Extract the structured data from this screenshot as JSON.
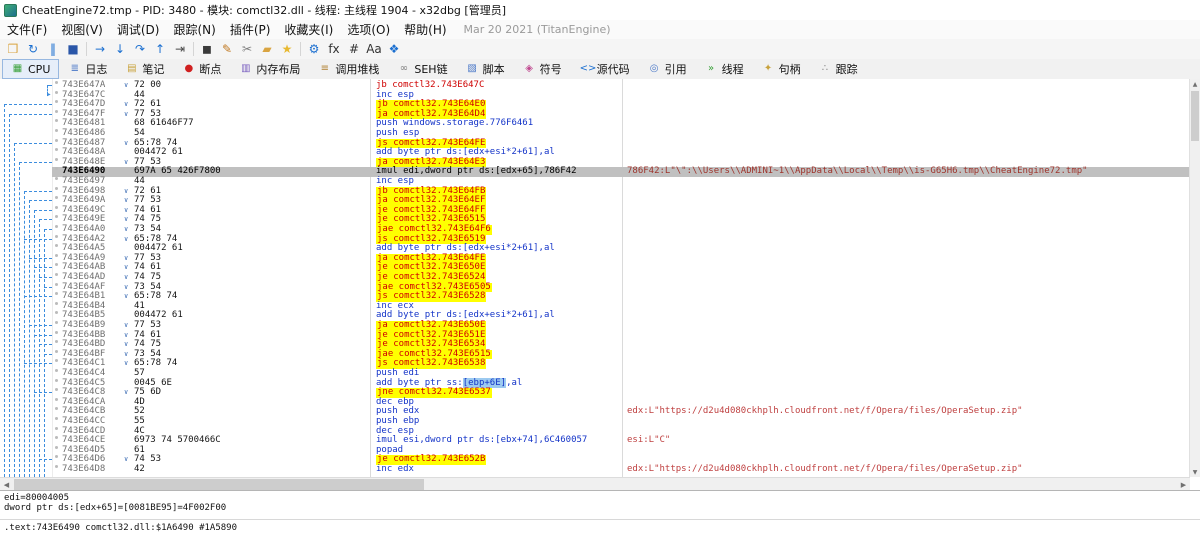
{
  "title_bar": {
    "title": "CheatEngine72.tmp - PID: 3480 - 模块: comctl32.dll - 线程: 主线程 1904 - x32dbg [管理员]"
  },
  "menu_bar": {
    "items": [
      {
        "label": "文件(F)",
        "name": "menu-file"
      },
      {
        "label": "视图(V)",
        "name": "menu-view"
      },
      {
        "label": "调试(D)",
        "name": "menu-debug"
      },
      {
        "label": "跟踪(N)",
        "name": "menu-trace"
      },
      {
        "label": "插件(P)",
        "name": "menu-plugins"
      },
      {
        "label": "收藏夹(I)",
        "name": "menu-favourites"
      },
      {
        "label": "选项(O)",
        "name": "menu-options"
      },
      {
        "label": "帮助(H)",
        "name": "menu-help"
      }
    ],
    "build_info": "Mar 20 2021 (TitanEngine)"
  },
  "toolbar": {
    "buttons": [
      {
        "name": "open-file",
        "glyph": "❒",
        "color": "#d9a441"
      },
      {
        "name": "restart",
        "glyph": "↻",
        "color": "#1b6fd0"
      },
      {
        "name": "pause",
        "glyph": "‖",
        "color": "#1b6fd0"
      },
      {
        "name": "stop",
        "glyph": "■",
        "color": "#2a56a8"
      },
      {
        "sep": true
      },
      {
        "name": "run",
        "glyph": "→",
        "color": "#1b6fd0"
      },
      {
        "name": "step-into",
        "glyph": "↓",
        "color": "#1b6fd0"
      },
      {
        "name": "step-over",
        "glyph": "↷",
        "color": "#1b6fd0"
      },
      {
        "name": "step-out",
        "glyph": "↑",
        "color": "#1b6fd0"
      },
      {
        "name": "run-to-user-code",
        "glyph": "⇥",
        "color": "#4a4a4a"
      },
      {
        "sep": true
      },
      {
        "name": "animate-into",
        "glyph": "◼",
        "color": "#3a3a3a"
      },
      {
        "name": "notes-pencil",
        "glyph": "✎",
        "color": "#c07820"
      },
      {
        "name": "snip",
        "glyph": "✂",
        "color": "#808080"
      },
      {
        "name": "patches",
        "glyph": "▰",
        "color": "#d9a441"
      },
      {
        "name": "favourites",
        "glyph": "★",
        "color": "#e8b931"
      },
      {
        "sep": true
      },
      {
        "name": "settings-gear",
        "glyph": "⚙",
        "color": "#1b6fd0"
      },
      {
        "name": "calculator-fx",
        "glyph": "fx",
        "color": "#333333"
      },
      {
        "name": "breakpoint-hash",
        "glyph": "#",
        "color": "#333333"
      },
      {
        "name": "strings-az",
        "glyph": "Aa",
        "color": "#333333"
      },
      {
        "name": "appearance-window",
        "glyph": "❖",
        "color": "#1b6fd0"
      }
    ]
  },
  "tab_bar": {
    "tabs": [
      {
        "name": "tab-cpu",
        "label": "CPU",
        "icon": "cpu-icon",
        "glyph": "▦",
        "color": "#3aa13a",
        "active": true
      },
      {
        "name": "tab-log",
        "label": "日志",
        "icon": "log-icon",
        "glyph": "≣",
        "color": "#4a78c8",
        "active": false
      },
      {
        "name": "tab-notes",
        "label": "笔记",
        "icon": "notes-icon",
        "glyph": "▤",
        "color": "#c8a23c",
        "active": false
      },
      {
        "name": "tab-breakpoints",
        "label": "断点",
        "icon": "breakpoint-icon",
        "glyph": "●",
        "color": "#d02020",
        "active": false
      },
      {
        "name": "tab-memory-map",
        "label": "内存布局",
        "icon": "memory-map-icon",
        "glyph": "▥",
        "color": "#7a5fc0",
        "active": false
      },
      {
        "name": "tab-call-stack",
        "label": "调用堆栈",
        "icon": "call-stack-icon",
        "glyph": "≡",
        "color": "#b08030",
        "active": false
      },
      {
        "name": "tab-seh",
        "label": "SEH链",
        "icon": "seh-chain-icon",
        "glyph": "∞",
        "color": "#808080",
        "active": false
      },
      {
        "name": "tab-script",
        "label": "脚本",
        "icon": "script-icon",
        "glyph": "▧",
        "color": "#4a78c8",
        "active": false
      },
      {
        "name": "tab-symbols",
        "label": "符号",
        "icon": "symbols-icon",
        "glyph": "◈",
        "color": "#c04a90",
        "active": false
      },
      {
        "name": "tab-source",
        "label": "源代码",
        "icon": "source-icon",
        "glyph": "<>",
        "color": "#1b6fd0",
        "active": false
      },
      {
        "name": "tab-references",
        "label": "引用",
        "icon": "references-icon",
        "glyph": "◎",
        "color": "#4a78c8",
        "active": false
      },
      {
        "name": "tab-threads",
        "label": "线程",
        "icon": "threads-icon",
        "glyph": "»",
        "color": "#3aa13a",
        "active": false
      },
      {
        "name": "tab-handles",
        "label": "句柄",
        "icon": "handles-icon",
        "glyph": "✦",
        "color": "#c8a23c",
        "active": false
      },
      {
        "name": "tab-trace",
        "label": "跟踪",
        "icon": "trace-icon",
        "glyph": "∴",
        "color": "#888888",
        "active": false
      }
    ]
  },
  "disassembly": {
    "rows": [
      {
        "a": "743E647A",
        "b": "72 00",
        "d": "jb comctl32.743E647C",
        "f": "red mark"
      },
      {
        "a": "743E647C",
        "b": "44",
        "d": "inc esp"
      },
      {
        "a": "743E647D",
        "b": "72 61",
        "d": "jb comctl32.743E64E0",
        "f": "hl mark"
      },
      {
        "a": "743E647F",
        "b": "77 53",
        "d": "ja comctl32.743E64D4",
        "f": "hl mark"
      },
      {
        "a": "743E6481",
        "b": "68 61646F77",
        "d": "push windows.storage.776F6461"
      },
      {
        "a": "743E6486",
        "b": "54",
        "d": "push esp"
      },
      {
        "a": "743E6487",
        "b": "65:78 74",
        "d": "js comctl32.743E64FE",
        "f": "hl mark"
      },
      {
        "a": "743E648A",
        "b": "004472 61",
        "d": "add byte ptr ds:[edx+esi*2+61],al"
      },
      {
        "a": "743E648E",
        "b": "77 53",
        "d": "ja comctl32.743E64E3",
        "f": "hl mark"
      },
      {
        "a": "743E6490",
        "b": "697A 65 426F7800",
        "d": "imul edi,dword ptr ds:[edx+65],786F42",
        "f": "sel",
        "c": "786F42:L\"\\\":\\\\Users\\\\ADMINI~1\\\\AppData\\\\Local\\\\Temp\\\\is-G65H6.tmp\\\\CheatEngine72.tmp\""
      },
      {
        "a": "743E6497",
        "b": "44",
        "d": "inc esp"
      },
      {
        "a": "743E6498",
        "b": "72 61",
        "d": "jb comctl32.743E64FB",
        "f": "hl mark"
      },
      {
        "a": "743E649A",
        "b": "77 53",
        "d": "ja comctl32.743E64EF",
        "f": "hl mark"
      },
      {
        "a": "743E649C",
        "b": "74 61",
        "d": "je comctl32.743E64FF",
        "f": "hl mark"
      },
      {
        "a": "743E649E",
        "b": "74 75",
        "d": "je comctl32.743E6515",
        "f": "hl mark"
      },
      {
        "a": "743E64A0",
        "b": "73 54",
        "d": "jae comctl32.743E64F6",
        "f": "hl mark"
      },
      {
        "a": "743E64A2",
        "b": "65:78 74",
        "d": "js comctl32.743E6519",
        "f": "hl mark"
      },
      {
        "a": "743E64A5",
        "b": "004472 61",
        "d": "add byte ptr ds:[edx+esi*2+61],al"
      },
      {
        "a": "743E64A9",
        "b": "77 53",
        "d": "ja comctl32.743E64FE",
        "f": "hl mark"
      },
      {
        "a": "743E64AB",
        "b": "74 61",
        "d": "je comctl32.743E650E",
        "f": "hl mark"
      },
      {
        "a": "743E64AD",
        "b": "74 75",
        "d": "je comctl32.743E6524",
        "f": "hl mark"
      },
      {
        "a": "743E64AF",
        "b": "73 54",
        "d": "jae comctl32.743E6505",
        "f": "hl mark"
      },
      {
        "a": "743E64B1",
        "b": "65:78 74",
        "d": "js comctl32.743E6528",
        "f": "hl mark"
      },
      {
        "a": "743E64B4",
        "b": "41",
        "d": "inc ecx"
      },
      {
        "a": "743E64B5",
        "b": "004472 61",
        "d": "add byte ptr ds:[edx+esi*2+61],al"
      },
      {
        "a": "743E64B9",
        "b": "77 53",
        "d": "ja comctl32.743E650E",
        "f": "hl mark"
      },
      {
        "a": "743E64BB",
        "b": "74 61",
        "d": "je comctl32.743E651E",
        "f": "hl mark"
      },
      {
        "a": "743E64BD",
        "b": "74 75",
        "d": "je comctl32.743E6534",
        "f": "hl mark"
      },
      {
        "a": "743E64BF",
        "b": "73 54",
        "d": "jae comctl32.743E6515",
        "f": "hl mark"
      },
      {
        "a": "743E64C1",
        "b": "65:78 74",
        "d": "js comctl32.743E6538",
        "f": "hl mark"
      },
      {
        "a": "743E64C4",
        "b": "57",
        "d": "push edi"
      },
      {
        "a": "743E64C5",
        "b": "0045 6E",
        "d": "add byte ptr ss:[ebp+6E],al",
        "tok": [
          "add byte ptr ss:",
          "[ebp+6E]",
          ",al"
        ]
      },
      {
        "a": "743E64C8",
        "b": "75 6D",
        "d": "jne comctl32.743E6537",
        "f": "hl mark"
      },
      {
        "a": "743E64CA",
        "b": "4D",
        "d": "dec ebp"
      },
      {
        "a": "743E64CB",
        "b": "52",
        "d": "push edx",
        "c": "edx:L\"https://d2u4d080ckhplh.cloudfront.net/f/Opera/files/OperaSetup.zip\""
      },
      {
        "a": "743E64CC",
        "b": "55",
        "d": "push ebp"
      },
      {
        "a": "743E64CD",
        "b": "4C",
        "d": "dec esp"
      },
      {
        "a": "743E64CE",
        "b": "6973 74 5700466C",
        "d": "imul esi,dword ptr ds:[ebx+74],6C460057",
        "c": "esi:L\"C\""
      },
      {
        "a": "743E64D5",
        "b": "61",
        "d": "popad"
      },
      {
        "a": "743E64D6",
        "b": "74 53",
        "d": "je comctl32.743E652B",
        "f": "hl mark"
      },
      {
        "a": "743E64D8",
        "b": "42",
        "d": "inc edx",
        "c": "edx:L\"https://d2u4d080ckhplh.cloudfront.net/f/Opera/files/OperaSetup.zip\""
      }
    ],
    "jump_arrows": [
      {
        "row": 1,
        "x": 47,
        "arc_to": 2
      },
      {
        "row": 3,
        "x": 4
      },
      {
        "row": 4,
        "x": 9
      },
      {
        "row": 7,
        "x": 14
      },
      {
        "row": 9,
        "x": 19
      },
      {
        "row": 12,
        "x": 24
      },
      {
        "row": 13,
        "x": 29
      },
      {
        "row": 14,
        "x": 34
      },
      {
        "row": 15,
        "x": 39
      },
      {
        "row": 16,
        "x": 44
      },
      {
        "row": 17,
        "x": 24,
        "stub": true
      },
      {
        "row": 19,
        "x": 29,
        "stub": true
      },
      {
        "row": 20,
        "x": 34,
        "stub": true
      },
      {
        "row": 21,
        "x": 39,
        "stub": true
      },
      {
        "row": 22,
        "x": 44,
        "stub": true
      },
      {
        "row": 23,
        "x": 24,
        "stub": true
      },
      {
        "row": 26,
        "x": 29,
        "stub": true
      },
      {
        "row": 27,
        "x": 34,
        "stub": true
      },
      {
        "row": 28,
        "x": 39,
        "stub": true
      },
      {
        "row": 29,
        "x": 44,
        "stub": true
      },
      {
        "row": 30,
        "x": 24,
        "stub": true
      },
      {
        "row": 33,
        "x": 34,
        "stub": true
      },
      {
        "row": 40,
        "x": 39,
        "stub": true
      }
    ]
  },
  "info_panel": {
    "line1": "edi=80004005",
    "line2": "dword ptr ds:[edx+65]=[0081BE95]=4F002F00",
    "address_line": ".text:743E6490 comctl32.dll:$1A6490 #1A5890"
  },
  "colors": {
    "highlight_yellow": "#ffff00",
    "jump_red": "#cf0000",
    "instruction_blue": "#1434c8",
    "comment_red": "#bf4040",
    "selection_gray": "#c0c0c0",
    "arrow_blue": "#3c8dde"
  }
}
